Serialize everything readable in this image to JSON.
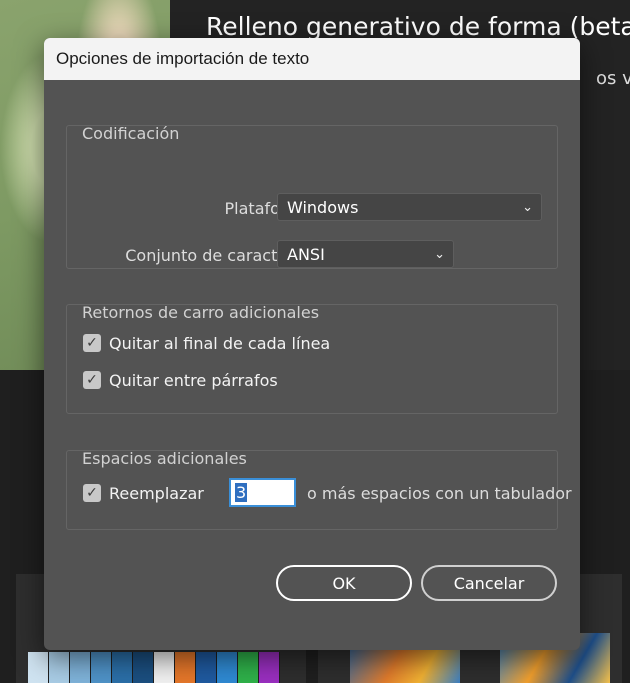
{
  "background": {
    "title": "Relleno generativo de forma (beta)",
    "subtitle": "os vec"
  },
  "dialog": {
    "title": "Opciones de importación de texto",
    "encoding": {
      "group_title": "Codificación",
      "platform_label": "Plataforma:",
      "platform_value": "Windows",
      "charset_label": "Conjunto de caracteres:",
      "charset_value": "ANSI"
    },
    "extra_returns": {
      "group_title": "Retornos de carro adicionales",
      "remove_line_end_label": "Quitar al final de cada línea",
      "remove_line_end_checked": true,
      "remove_between_paragraphs_label": "Quitar entre párrafos",
      "remove_between_paragraphs_checked": true
    },
    "extra_spaces": {
      "group_title": "Espacios adicionales",
      "replace_label": "Reemplazar",
      "replace_checked": true,
      "spaces_count": "3",
      "replace_suffix": "o más espacios con un tabulador"
    },
    "ok_label": "OK",
    "cancel_label": "Cancelar"
  },
  "icons": {
    "checkmark": "✓",
    "chevron": "⌄"
  },
  "colors": {
    "dialog_bg": "#535353",
    "titlebar_bg": "#f3f3f3",
    "focus_blue": "#3a8fd8"
  }
}
